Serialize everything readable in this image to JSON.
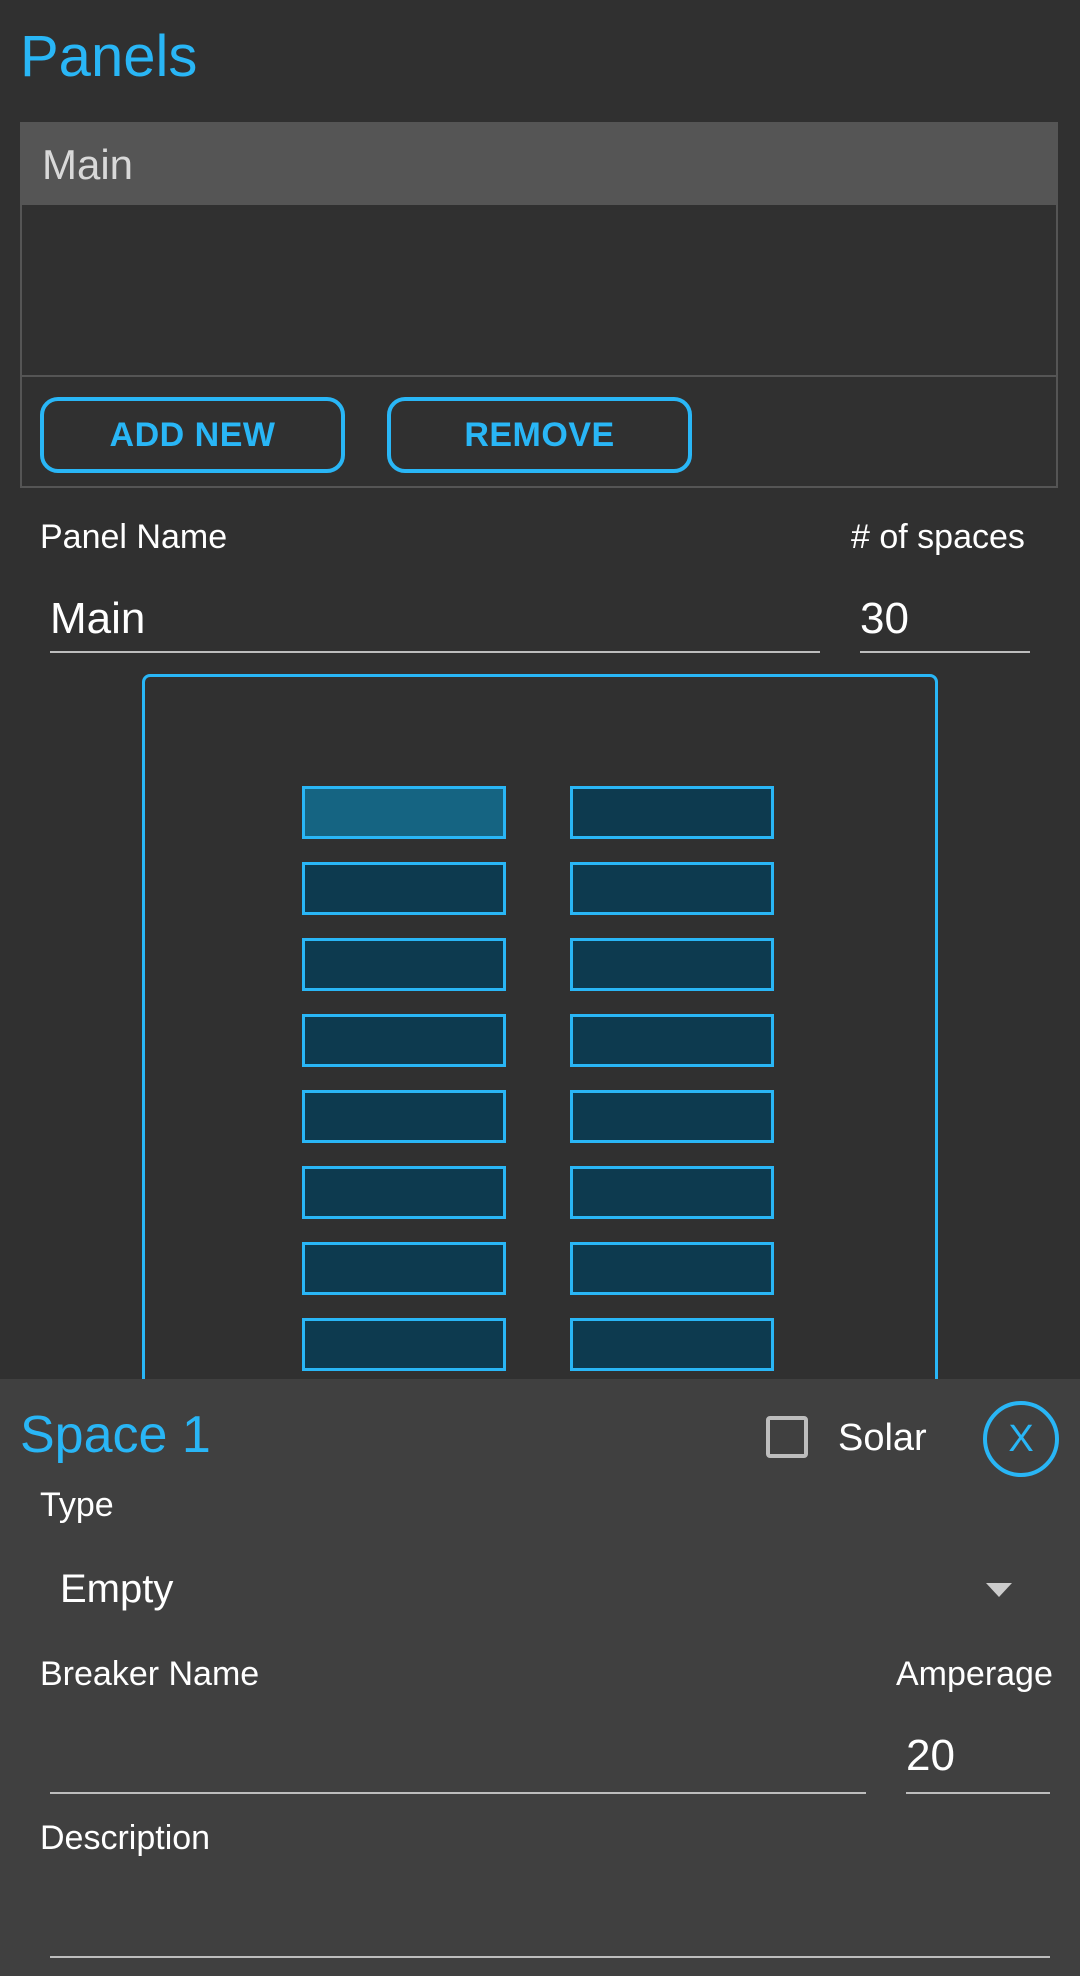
{
  "header": {
    "title": "Panels"
  },
  "panel_list": {
    "items": [
      {
        "label": "Main"
      }
    ],
    "add_button": "ADD NEW",
    "remove_button": "REMOVE"
  },
  "panel_form": {
    "name_label": "Panel Name",
    "name_value": "Main",
    "spaces_label": "# of spaces",
    "spaces_value": "30"
  },
  "breaker_panel": {
    "rows_visible": 8,
    "columns": 2,
    "selected_space": 1,
    "accent_color": "#29b6f6"
  },
  "space_sheet": {
    "title": "Space 1",
    "solar_label": "Solar",
    "solar_checked": false,
    "close_label": "X",
    "type_label": "Type",
    "type_value": "Empty",
    "breaker_name_label": "Breaker Name",
    "breaker_name_value": "",
    "amperage_label": "Amperage",
    "amperage_value": "20",
    "description_label": "Description",
    "description_value": ""
  }
}
